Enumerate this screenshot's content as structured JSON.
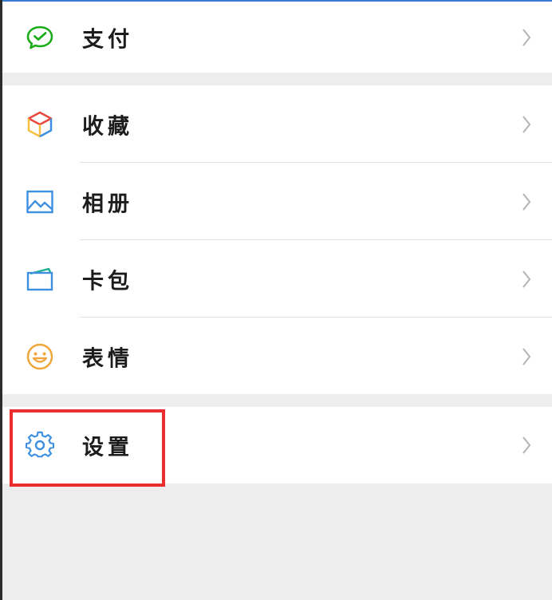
{
  "menu": {
    "pay": {
      "label": "支付",
      "icon": "wechat-pay-icon",
      "color": "#1aad19"
    },
    "favorites": {
      "label": "收藏",
      "icon": "cube-icon",
      "colors": [
        "#e8493f",
        "#f5c044",
        "#3d8fe0"
      ]
    },
    "album": {
      "label": "相册",
      "icon": "image-icon",
      "color": "#3d8fe0"
    },
    "cards": {
      "label": "卡包",
      "icon": "card-icon",
      "color": "#3d8fe0"
    },
    "stickers": {
      "label": "表情",
      "icon": "smiley-icon",
      "color": "#f0a63a"
    },
    "settings": {
      "label": "设置",
      "icon": "gear-icon",
      "color": "#3d8fe0"
    }
  },
  "highlight": {
    "target": "settings",
    "color": "#ec2d2d"
  }
}
